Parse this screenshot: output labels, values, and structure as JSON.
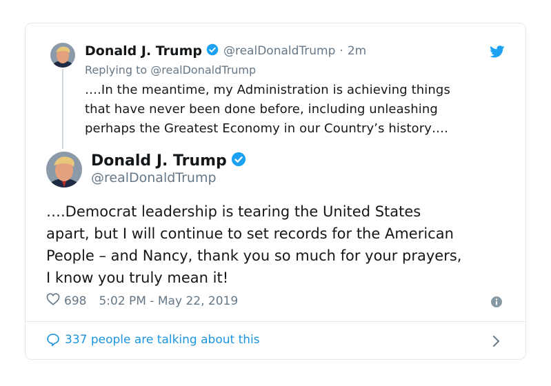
{
  "parent_tweet": {
    "author_name": "Donald J. Trump",
    "author_handle": "@realDonaldTrump",
    "separator": "·",
    "time_ago": "2m",
    "replying_to": "Replying to @realDonaldTrump",
    "text_lines": [
      "….In the meantime, my Administration is achieving things",
      "that have never been done before, including unleashing",
      "perhaps the Greatest Economy in our Country’s history…."
    ],
    "verified": true
  },
  "main_tweet": {
    "author_name": "Donald J. Trump",
    "author_handle": "@realDonaldTrump",
    "verified": true,
    "text_lines": [
      "….Democrat leadership is tearing the United States",
      "apart, but I will continue to set records for the American",
      "People – and Nancy, thank you so much for your prayers,",
      "I know you truly mean it!"
    ],
    "likes": "698",
    "timestamp": "5:02 PM - May 22, 2019"
  },
  "footer": {
    "talking_label": "337 people are talking about this"
  },
  "icons": {
    "verified": "verified-badge-icon",
    "twitter": "twitter-bird-icon",
    "heart": "heart-icon",
    "info": "info-icon",
    "comment": "speech-bubble-icon",
    "chevron": "chevron-right-icon"
  },
  "colors": {
    "brand_blue": "#1da1f2",
    "link_blue": "#1b95e0",
    "text": "#14171a",
    "muted": "#657786",
    "border": "#e1e8ed"
  }
}
